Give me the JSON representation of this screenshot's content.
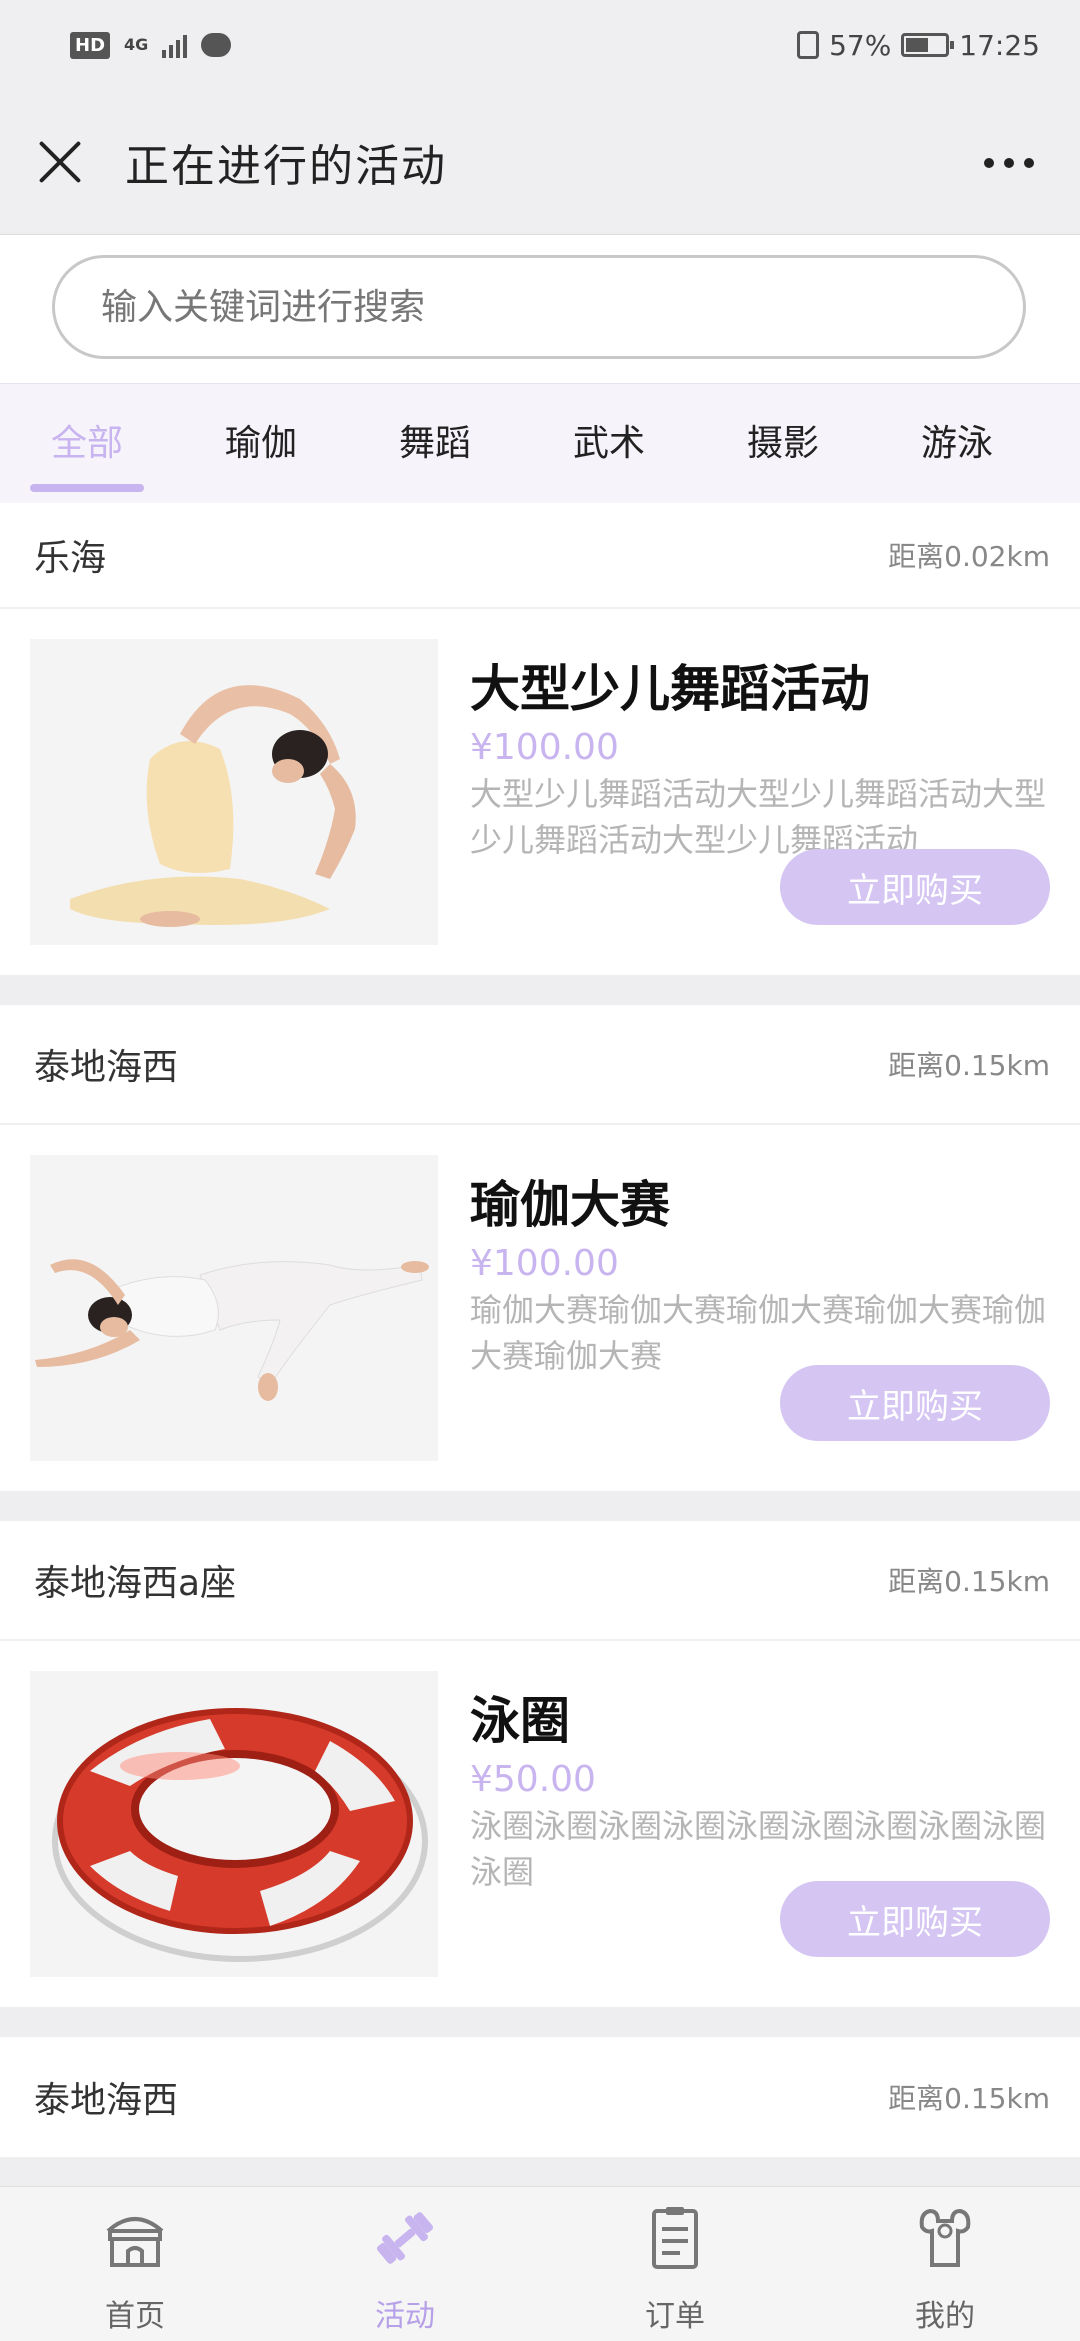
{
  "status_bar": {
    "hd": "HD",
    "network": "4G",
    "battery": "57%",
    "time": "17:25"
  },
  "header": {
    "title": "正在进行的活动"
  },
  "search": {
    "placeholder": "输入关键词进行搜索"
  },
  "tabs": [
    "全部",
    "瑜伽",
    "舞蹈",
    "武术",
    "摄影",
    "游泳"
  ],
  "active_tab": "全部",
  "colors": {
    "accent": "#c8b4ef",
    "button": "#d5c5f3"
  },
  "cards": [
    {
      "store": "乐海",
      "distance": "距离0.02km",
      "title": "大型少儿舞蹈活动",
      "price": "¥100.00",
      "description": "大型少儿舞蹈活动大型少儿舞蹈活动大型少儿舞蹈活动大型少儿舞蹈活动",
      "button": "立即购买",
      "image": "yoga-backbend-photo"
    },
    {
      "store": "泰地海西",
      "distance": "距离0.15km",
      "title": "瑜伽大赛",
      "price": "¥100.00",
      "description": "瑜伽大赛瑜伽大赛瑜伽大赛瑜伽大赛瑜伽大赛瑜伽大赛",
      "button": "立即购买",
      "image": "yoga-reclining-photo"
    },
    {
      "store": "泰地海西a座",
      "distance": "距离0.15km",
      "title": "泳圈",
      "price": "¥50.00",
      "description": "泳圈泳圈泳圈泳圈泳圈泳圈泳圈泳圈泳圈泳圈",
      "button": "立即购买",
      "image": "swim-ring-photo"
    }
  ],
  "partial_card": {
    "store": "泰地海西",
    "distance": "距离0.15km"
  },
  "bottom_nav": [
    {
      "label": "首页",
      "icon": "home-building-icon"
    },
    {
      "label": "活动",
      "icon": "dumbbell-icon"
    },
    {
      "label": "订单",
      "icon": "order-clipboard-icon"
    },
    {
      "label": "我的",
      "icon": "muscle-person-icon"
    }
  ],
  "active_nav": "活动"
}
